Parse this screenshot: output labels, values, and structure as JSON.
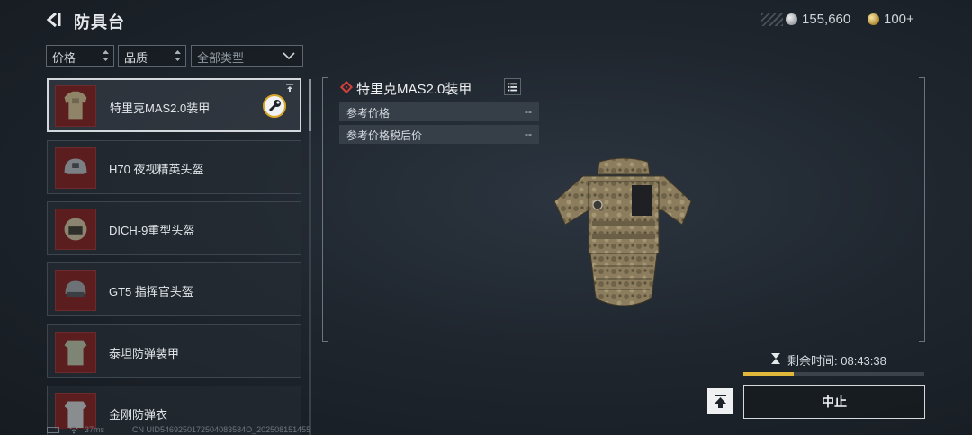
{
  "header": {
    "title": "防具台",
    "currency_silver": "155,660",
    "currency_gold": "100+"
  },
  "filters": {
    "price": "价格",
    "quality": "品质",
    "type": "全部类型"
  },
  "items": [
    {
      "name": "特里克MAS2.0装甲",
      "selected": true
    },
    {
      "name": "H70 夜视精英头盔"
    },
    {
      "name": "DICH-9重型头盔"
    },
    {
      "name": "GT5 指挥官头盔"
    },
    {
      "name": "泰坦防弹装甲"
    },
    {
      "name": "金刚防弹衣"
    }
  ],
  "detail": {
    "name": "特里克MAS2.0装甲",
    "prices": [
      {
        "label": "参考价格",
        "value": "--"
      },
      {
        "label": "参考价格税后价",
        "value": "--"
      }
    ]
  },
  "craft": {
    "timer_label": "剩余时间:",
    "timer_value": "08:43:38",
    "progress": 0.28,
    "stop_label": "中止"
  },
  "status_bar": {
    "latency": "37ms",
    "uid": "CN UID5469250172504083584O_202508151455"
  },
  "colors": {
    "accent_gold": "#e0b93a",
    "rarity_red": "#d3403a",
    "thumb_bg": "#5b1d1e"
  }
}
